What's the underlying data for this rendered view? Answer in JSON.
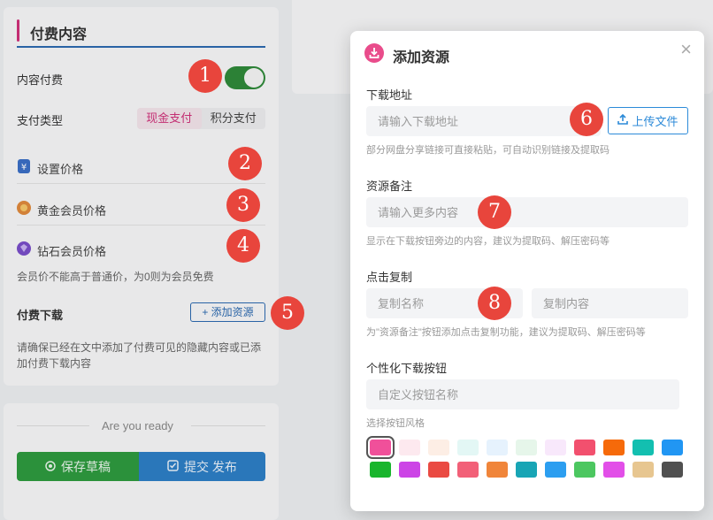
{
  "panel": {
    "title": "付费内容",
    "content_pay_label": "内容付费",
    "pay_type_label": "支付类型",
    "pay_types": [
      "现金支付",
      "积分支付"
    ],
    "price_rows": [
      {
        "label": "设置价格",
        "icon": "yen-tag-icon",
        "color": "#3b6fc6"
      },
      {
        "label": "黄金会员价格",
        "icon": "gold-member-icon",
        "color": "#e08a3c"
      },
      {
        "label": "钻石会员价格",
        "icon": "diamond-member-icon",
        "color": "#7a4ec9"
      }
    ],
    "member_note": "会员价不能高于普通价，为0则为会员免费",
    "paid_download_label": "付费下载",
    "add_resource_button": "添加资源",
    "warning": "请确保已经在文中添加了付费可见的隐藏内容或已添加付费下载内容"
  },
  "footer": {
    "ready_text": "Are you ready",
    "save_draft": "保存草稿",
    "submit": "提交 发布"
  },
  "modal": {
    "title": "添加资源",
    "download_url_label": "下载地址",
    "download_url_placeholder": "请输入下载地址",
    "upload_button": "上传文件",
    "download_hint": "部分网盘分享链接可直接粘贴，可自动识别链接及提取码",
    "note_label": "资源备注",
    "note_placeholder": "请输入更多内容",
    "note_hint": "显示在下载按钮旁边的内容，建议为提取码、解压密码等",
    "copy_label": "点击复制",
    "copy_name_placeholder": "复制名称",
    "copy_content_placeholder": "复制内容",
    "copy_hint": "为\"资源备注\"按钮添加点击复制功能，建议为提取码、解压密码等",
    "custom_button_label": "个性化下载按钮",
    "custom_button_placeholder": "自定义按钮名称",
    "style_label": "选择按钮风格",
    "swatches_row1": [
      "#f0509a",
      "#fde9ef",
      "#fdeee5",
      "#e3f7f5",
      "#e6f2fd",
      "#e6f6ea",
      "#f8e8fb",
      "#f2506e",
      "#f66a0a",
      "#13bfb0",
      "#2196f3"
    ],
    "swatches_row2": [
      "#19b52d",
      "#cc44e6",
      "#ea4a42",
      "#f26078",
      "#f0853a",
      "#18a5b5",
      "#2c9ef0",
      "#4cc760",
      "#e24fe8",
      "#e7c690",
      "#505050"
    ]
  },
  "markers": [
    "1",
    "2",
    "3",
    "4",
    "5",
    "6",
    "7",
    "8"
  ]
}
